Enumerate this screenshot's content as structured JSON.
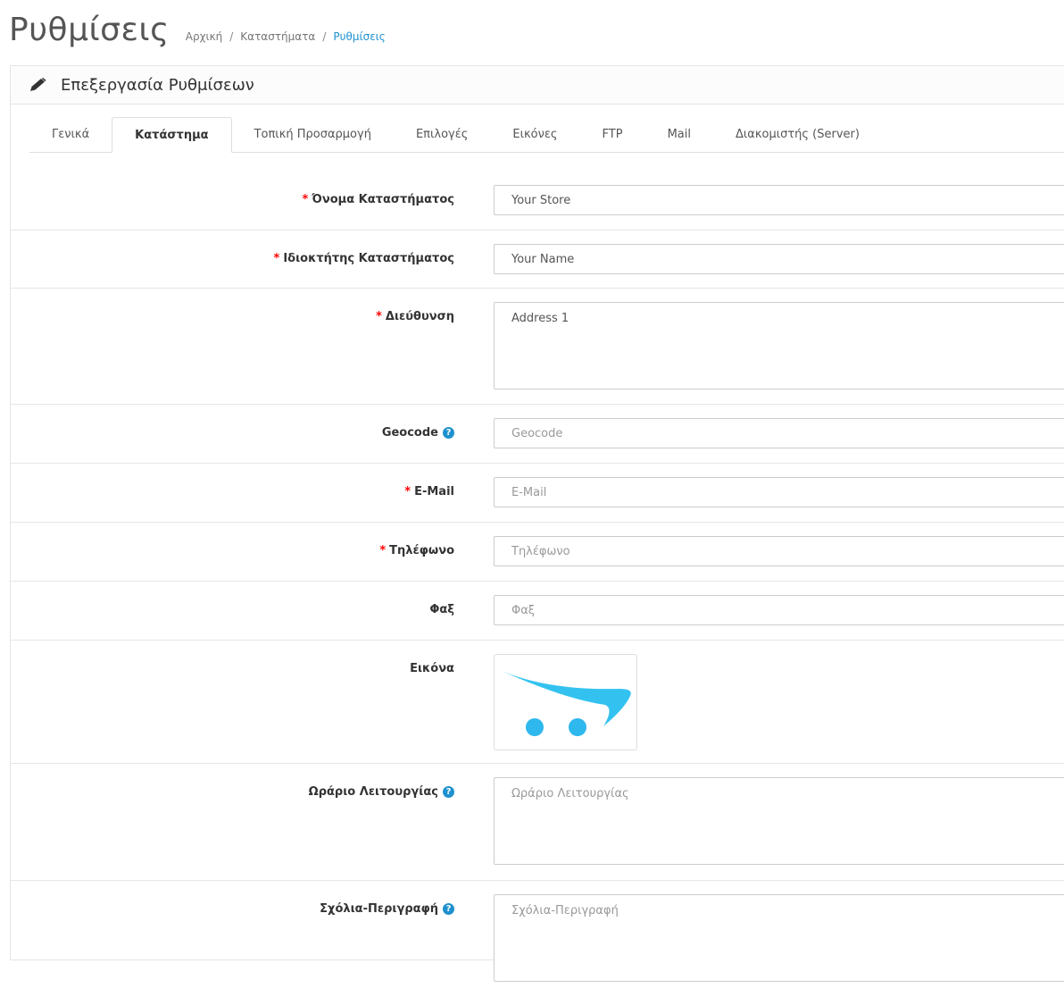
{
  "header": {
    "title": "Ρυθμίσεις",
    "breadcrumb": [
      "Αρχική",
      "Καταστήματα",
      "Ρυθμίσεις"
    ],
    "separator": "/"
  },
  "panel": {
    "title": "Επεξεργασία Ρυθμίσεων",
    "icon": "pencil-icon"
  },
  "tabs": [
    {
      "label": "Γενικά",
      "active": false
    },
    {
      "label": "Κατάστημα",
      "active": true
    },
    {
      "label": "Τοπική Προσαρμογή",
      "active": false
    },
    {
      "label": "Επιλογές",
      "active": false
    },
    {
      "label": "Εικόνες",
      "active": false
    },
    {
      "label": "FTP",
      "active": false
    },
    {
      "label": "Mail",
      "active": false
    },
    {
      "label": "Διακομιστής (Server)",
      "active": false
    }
  ],
  "form": {
    "required_marker": "*",
    "help_icon": "?",
    "store_name": {
      "label": "Όνομα Καταστήματος",
      "value": "Your Store",
      "required": true
    },
    "owner": {
      "label": "Ιδιοκτήτης Καταστήματος",
      "value": "Your Name",
      "required": true
    },
    "address": {
      "label": "Διεύθυνση",
      "value": "Address 1",
      "required": true
    },
    "geocode": {
      "label": "Geocode",
      "placeholder": "Geocode",
      "value": ""
    },
    "email": {
      "label": "E-Mail",
      "placeholder": "E-Mail",
      "value": "",
      "required": true
    },
    "telephone": {
      "label": "Τηλέφωνο",
      "placeholder": "Τηλέφωνο",
      "value": "",
      "required": true
    },
    "fax": {
      "label": "Φαξ",
      "placeholder": "Φαξ",
      "value": ""
    },
    "image": {
      "label": "Εικόνα",
      "icon": "shopping-cart-logo"
    },
    "opening_times": {
      "label": "Ωράριο Λειτουργίας",
      "placeholder": "Ωράριο Λειτουργίας",
      "value": ""
    },
    "comment": {
      "label": "Σχόλια-Περιγραφή",
      "placeholder": "Σχόλια-Περιγραφή",
      "value": ""
    }
  },
  "colors": {
    "link": "#1e91cf",
    "required": "#ff0000",
    "logo": "#33c2f0"
  }
}
